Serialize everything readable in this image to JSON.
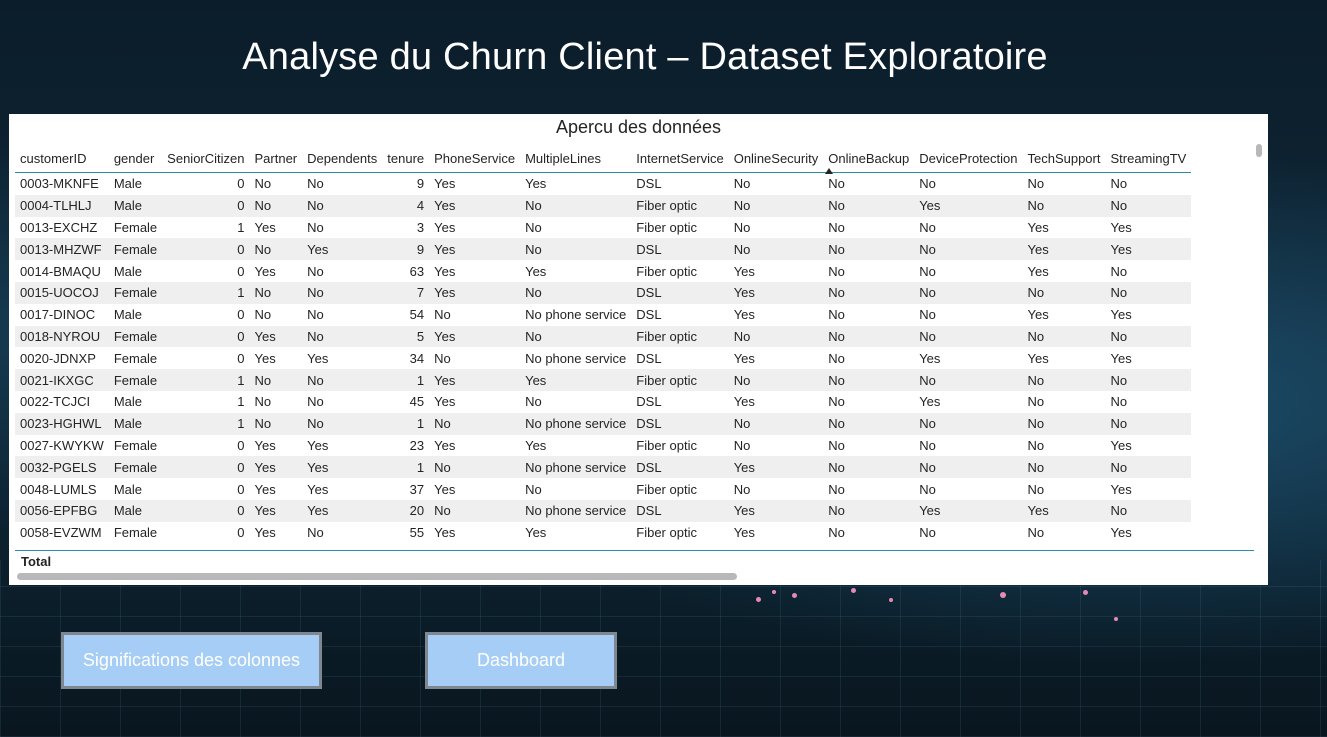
{
  "page": {
    "title": "Analyse du Churn Client – Dataset Exploratoire"
  },
  "table_panel": {
    "title": "Apercu des données",
    "columns": [
      "customerID",
      "gender",
      "SeniorCitizen",
      "Partner",
      "Dependents",
      "tenure",
      "PhoneService",
      "MultipleLines",
      "InternetService",
      "OnlineSecurity",
      "OnlineBackup",
      "DeviceProtection",
      "TechSupport",
      "StreamingTV"
    ],
    "numeric_columns": [
      2,
      5
    ],
    "sorted_column": 10,
    "rows": [
      [
        "0003-MKNFE",
        "Male",
        "0",
        "No",
        "No",
        "9",
        "Yes",
        "Yes",
        "DSL",
        "No",
        "No",
        "No",
        "No",
        "No"
      ],
      [
        "0004-TLHLJ",
        "Male",
        "0",
        "No",
        "No",
        "4",
        "Yes",
        "No",
        "Fiber optic",
        "No",
        "No",
        "Yes",
        "No",
        "No"
      ],
      [
        "0013-EXCHZ",
        "Female",
        "1",
        "Yes",
        "No",
        "3",
        "Yes",
        "No",
        "Fiber optic",
        "No",
        "No",
        "No",
        "Yes",
        "Yes"
      ],
      [
        "0013-MHZWF",
        "Female",
        "0",
        "No",
        "Yes",
        "9",
        "Yes",
        "No",
        "DSL",
        "No",
        "No",
        "No",
        "Yes",
        "Yes"
      ],
      [
        "0014-BMAQU",
        "Male",
        "0",
        "Yes",
        "No",
        "63",
        "Yes",
        "Yes",
        "Fiber optic",
        "Yes",
        "No",
        "No",
        "Yes",
        "No"
      ],
      [
        "0015-UOCOJ",
        "Female",
        "1",
        "No",
        "No",
        "7",
        "Yes",
        "No",
        "DSL",
        "Yes",
        "No",
        "No",
        "No",
        "No"
      ],
      [
        "0017-DINOC",
        "Male",
        "0",
        "No",
        "No",
        "54",
        "No",
        "No phone service",
        "DSL",
        "Yes",
        "No",
        "No",
        "Yes",
        "Yes"
      ],
      [
        "0018-NYROU",
        "Female",
        "0",
        "Yes",
        "No",
        "5",
        "Yes",
        "No",
        "Fiber optic",
        "No",
        "No",
        "No",
        "No",
        "No"
      ],
      [
        "0020-JDNXP",
        "Female",
        "0",
        "Yes",
        "Yes",
        "34",
        "No",
        "No phone service",
        "DSL",
        "Yes",
        "No",
        "Yes",
        "Yes",
        "Yes"
      ],
      [
        "0021-IKXGC",
        "Female",
        "1",
        "No",
        "No",
        "1",
        "Yes",
        "Yes",
        "Fiber optic",
        "No",
        "No",
        "No",
        "No",
        "No"
      ],
      [
        "0022-TCJCI",
        "Male",
        "1",
        "No",
        "No",
        "45",
        "Yes",
        "No",
        "DSL",
        "Yes",
        "No",
        "Yes",
        "No",
        "No"
      ],
      [
        "0023-HGHWL",
        "Male",
        "1",
        "No",
        "No",
        "1",
        "No",
        "No phone service",
        "DSL",
        "No",
        "No",
        "No",
        "No",
        "No"
      ],
      [
        "0027-KWYKW",
        "Female",
        "0",
        "Yes",
        "Yes",
        "23",
        "Yes",
        "Yes",
        "Fiber optic",
        "No",
        "No",
        "No",
        "No",
        "Yes"
      ],
      [
        "0032-PGELS",
        "Female",
        "0",
        "Yes",
        "Yes",
        "1",
        "No",
        "No phone service",
        "DSL",
        "Yes",
        "No",
        "No",
        "No",
        "No"
      ],
      [
        "0048-LUMLS",
        "Male",
        "0",
        "Yes",
        "Yes",
        "37",
        "Yes",
        "No",
        "Fiber optic",
        "No",
        "No",
        "No",
        "No",
        "Yes"
      ],
      [
        "0056-EPFBG",
        "Male",
        "0",
        "Yes",
        "Yes",
        "20",
        "No",
        "No phone service",
        "DSL",
        "Yes",
        "No",
        "Yes",
        "Yes",
        "No"
      ],
      [
        "0058-EVZWM",
        "Female",
        "0",
        "Yes",
        "No",
        "55",
        "Yes",
        "Yes",
        "Fiber optic",
        "Yes",
        "No",
        "No",
        "No",
        "Yes"
      ]
    ],
    "total_label": "Total"
  },
  "buttons": {
    "columns_meaning": "Significations des colonnes",
    "dashboard": "Dashboard"
  }
}
